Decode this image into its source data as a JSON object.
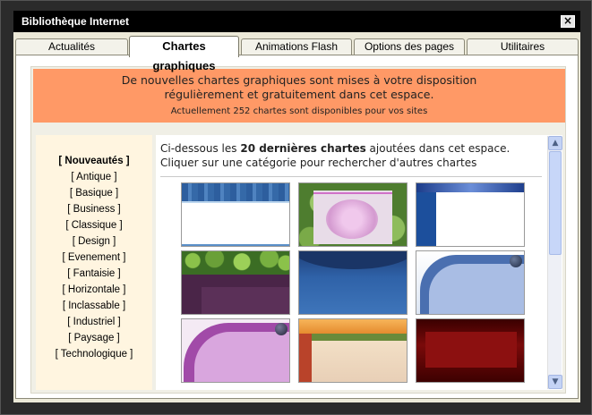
{
  "window": {
    "title": "Bibliothèque Internet"
  },
  "tabs": [
    {
      "label": "Actualités"
    },
    {
      "label": "Chartes graphiques",
      "active": true
    },
    {
      "label": "Animations Flash"
    },
    {
      "label": "Options des pages"
    },
    {
      "label": "Utilitaires"
    }
  ],
  "banner": {
    "line1": "De nouvelles chartes graphiques sont mises à votre disposition",
    "line2": "régulièrement et gratuitement dans cet espace.",
    "sub": "Actuellement 252 chartes sont disponibles pour vos sites"
  },
  "categories": [
    "[ Nouveautés ]",
    "[ Antique ]",
    "[ Basique ]",
    "[ Business ]",
    "[ Classique ]",
    "[ Design ]",
    "[ Evenement ]",
    "[ Fantaisie ]",
    "[ Horizontale ]",
    "[ Inclassable ]",
    "[ Industriel ]",
    "[ Paysage ]",
    "[ Technologique ]"
  ],
  "intro": {
    "pre": "Ci-dessous les ",
    "bold": "20 dernières chartes",
    "post": " ajoutées dans cet espace.",
    "line2": "Cliquer sur une catégorie pour rechercher d'autres chartes"
  },
  "icons": {
    "close": "close-icon",
    "scroll_up": "scroll-up-icon",
    "scroll_down": "scroll-down-icon"
  },
  "colors": {
    "banner": "#ff9966",
    "sidebar": "#fff5e0",
    "titlebar": "#000000"
  }
}
